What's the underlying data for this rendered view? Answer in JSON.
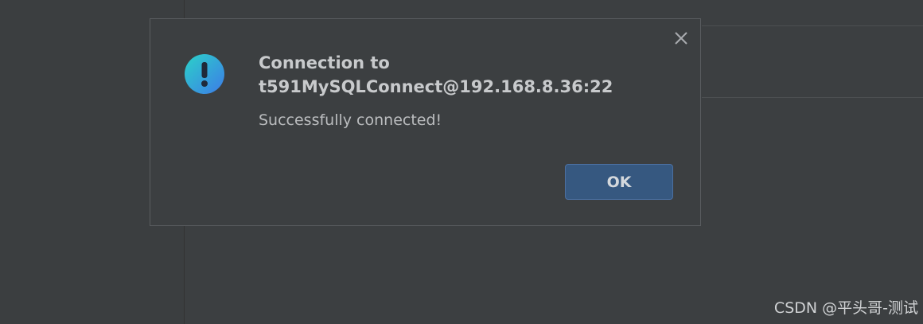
{
  "dialog": {
    "title_line1": "Connection to",
    "title_line2": "t591MySQLConnect@192.168.8.36:22",
    "message": "Successfully connected!",
    "ok_label": "OK",
    "icon": "alert-icon",
    "close_icon": "close-icon"
  },
  "watermark": {
    "text": "CSDN @平头哥-测试"
  },
  "colors": {
    "background": "#3c3f41",
    "button": "#365880",
    "icon_gradient_start": "#2bd2c8",
    "icon_gradient_end": "#3d7be8"
  }
}
